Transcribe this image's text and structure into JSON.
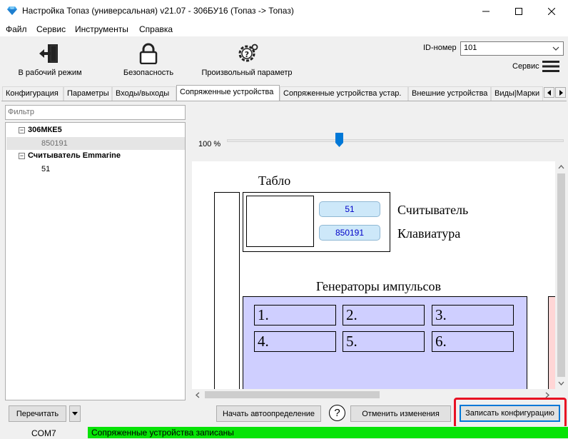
{
  "window": {
    "title": "Настройка Топаз (универсальная) v21.07 - 306БУ16 (Топаз -> Топаз)",
    "icon": "diamond-icon"
  },
  "menu": [
    "Файл",
    "Сервис",
    "Инструменты",
    "Справка"
  ],
  "toolbar": {
    "work_mode": "В рабочий режим",
    "security": "Безопасность",
    "custom_param": "Произвольный параметр",
    "id_label": "ID-номер",
    "id_value": "101",
    "service": "Сервис"
  },
  "tabs": [
    "Конфигурация",
    "Параметры",
    "Входы/выходы",
    "Сопряженные устройства",
    "Сопряженные устройства устар.",
    "Внешние устройства",
    "Виды|Марки"
  ],
  "active_tab_index": 3,
  "filter_placeholder": "Фильтр",
  "tree": [
    {
      "label": "306МКЕ5",
      "children": [
        "850191"
      ]
    },
    {
      "label": "Считыватель Emmarine",
      "children": [
        "51"
      ]
    }
  ],
  "zoom": "100 %",
  "zoom_level_fraction": 0.33,
  "diagram": {
    "tablo": "Табло",
    "reader_value": "51",
    "keypad_value": "850191",
    "reader_label": "Считыватель",
    "keypad_label": "Клавиатура",
    "generators_title": "Генераторы импульсов",
    "generators": [
      "1.",
      "2.",
      "3.",
      "4.",
      "5.",
      "6."
    ]
  },
  "buttons": {
    "reread": "Перечитать",
    "autodetect": "Начать автоопределение",
    "help": "?",
    "cancel": "Отменить изменения",
    "save": "Записать конфигурацию"
  },
  "status": {
    "port": "COM7",
    "message": "Сопряженные устройства записаны",
    "message_color": "#06e306"
  },
  "colors": {
    "highlight_frame": "#e81123",
    "generator_fill": "#cfcfff",
    "pill_fill": "#cde8f9"
  }
}
